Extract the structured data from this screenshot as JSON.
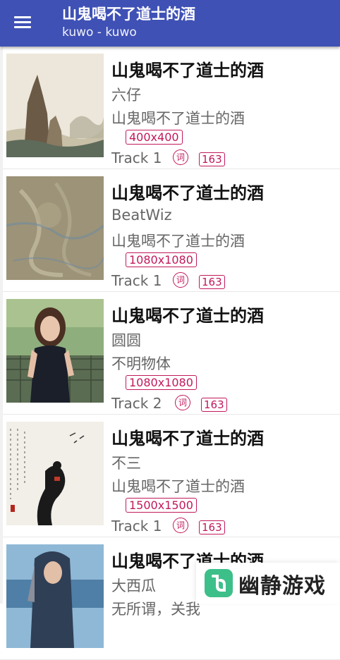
{
  "app": {
    "title": "山鬼喝不了道士的酒",
    "subtitle": "kuwo - kuwo"
  },
  "results": [
    {
      "title": "山鬼喝不了道士的酒",
      "artist": "六仔",
      "album": "山鬼喝不了道士的酒",
      "resolution": "400x400",
      "track": "Track 1",
      "lyric_icon": "词",
      "count": "163"
    },
    {
      "title": "山鬼喝不了道士的酒",
      "artist": "BeatWiz",
      "album": "山鬼喝不了道士的酒",
      "resolution": "1080x1080",
      "track": "Track 1",
      "lyric_icon": "词",
      "count": "163"
    },
    {
      "title": "山鬼喝不了道士的酒",
      "artist": "圆圆",
      "album": "不明物体",
      "resolution": "1080x1080",
      "track": "Track 2",
      "lyric_icon": "词",
      "count": "163"
    },
    {
      "title": "山鬼喝不了道士的酒",
      "artist": "不三",
      "album": "山鬼喝不了道士的酒",
      "resolution": "1500x1500",
      "track": "Track 1",
      "lyric_icon": "词",
      "count": "163"
    },
    {
      "title": "山鬼喝不了道士的酒",
      "artist": "大西瓜",
      "album": "无所谓，关我",
      "resolution": "",
      "track": "",
      "lyric_icon": "",
      "count": ""
    }
  ],
  "watermark": {
    "text": "幽静游戏"
  },
  "icons": {
    "menu": "menu-icon",
    "lyric": "lyric-badge-icon",
    "logo": "yj-logo-icon"
  },
  "colors": {
    "appbar": "#3f51b5",
    "accent": "#c2185b"
  }
}
